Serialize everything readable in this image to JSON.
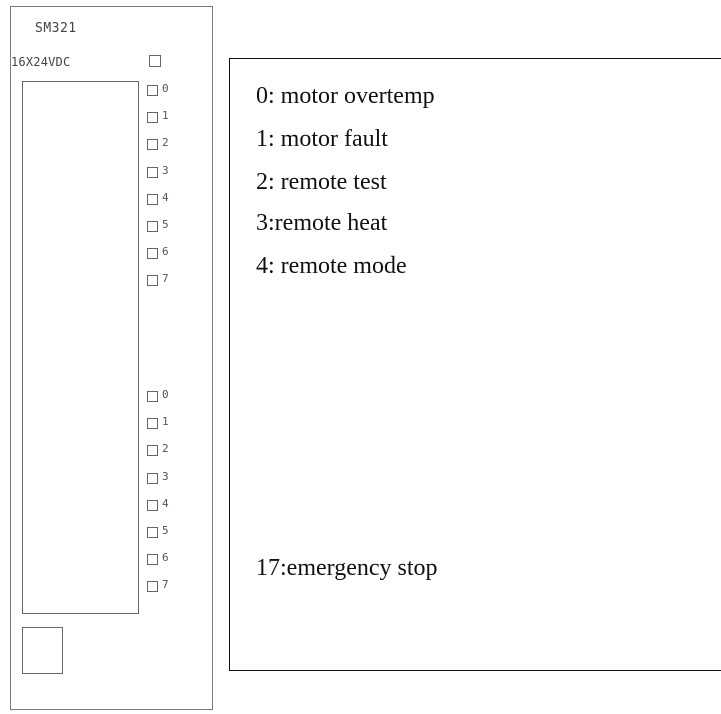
{
  "module": {
    "title": "SM321",
    "subtitle": "16X24VDC",
    "channel_groups": [
      {
        "channels": [
          "0",
          "1",
          "2",
          "3",
          "4",
          "5",
          "6",
          "7"
        ]
      },
      {
        "channels": [
          "0",
          "1",
          "2",
          "3",
          "4",
          "5",
          "6",
          "7"
        ]
      }
    ]
  },
  "legend": {
    "lines": [
      "0: motor overtemp",
      "1: motor fault",
      "2: remote test",
      "3:remote heat",
      "4: remote mode"
    ],
    "footer_line": "17:emergency stop"
  }
}
